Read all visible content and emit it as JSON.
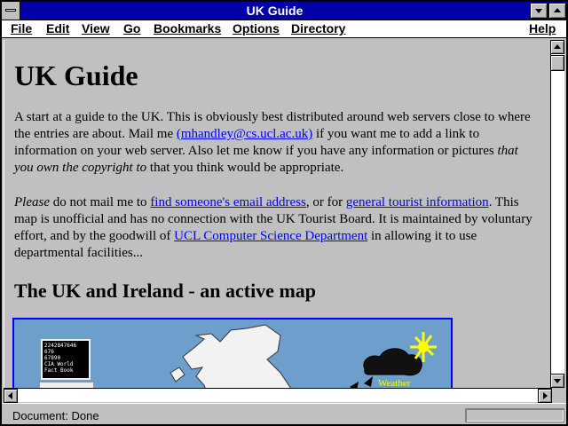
{
  "window": {
    "title": "UK Guide"
  },
  "menubar": {
    "items": [
      "File",
      "Edit",
      "View",
      "Go",
      "Bookmarks",
      "Options",
      "Directory"
    ],
    "help": "Help"
  },
  "content": {
    "heading": "UK Guide",
    "p1": {
      "text_a": "A start at a guide to the UK. This is obviously best distributed around web servers close to where the entries are about. Mail me ",
      "link_email": "(mhandley@cs.ucl.ac.uk)",
      "text_b": " if you want me to add a link to information on your web server. Also let me know if you have any information or pictures ",
      "italic": "that you own the copyright to",
      "text_c": " that you think would be appropriate."
    },
    "p2": {
      "italic": "Please",
      "text_a": " do not mail me to ",
      "link_email_search": "find someone's email address",
      "text_b": ", or for ",
      "link_tourist": "general tourist information",
      "text_c": ". This map is unofficial and has no connection with the UK Tourist Board. It is maintained by voluntary effort, and by the goodwill of ",
      "link_ucl": "UCL Computer Science Department",
      "text_d": " in allowing it to use departmental facilities..."
    },
    "map_heading": "The UK and Ireland - an active map",
    "map": {
      "factbook_lines": [
        "2242847646",
        "676",
        "67890",
        "CIA World",
        "Fact Book"
      ],
      "weather_label": "Weather"
    }
  },
  "status": {
    "text": "Document: Done"
  },
  "colors": {
    "titlebar": "#0000a8",
    "link": "#0000ff",
    "map_sea": "#6e9ecb",
    "weather": "#ffff00"
  }
}
